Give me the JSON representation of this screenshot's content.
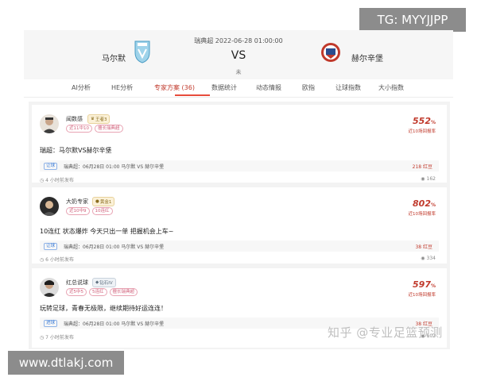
{
  "watermarks": {
    "top": "TG: MYYJJPP",
    "bottom": "www.dtlakj.com",
    "zhihu": "知乎 @专业足篮预测"
  },
  "match": {
    "meta": "瑞典超 2022-06-28 01:00:00",
    "home": "马尔默",
    "away": "赫尔辛堡",
    "vs": "VS",
    "state": "未"
  },
  "tabs": [
    {
      "label": "AI分析"
    },
    {
      "label": "HE分析"
    },
    {
      "label": "专家方案 (36)"
    },
    {
      "label": "数据统计"
    },
    {
      "label": "动态情报"
    },
    {
      "label": "欧指"
    },
    {
      "label": "让球指数"
    },
    {
      "label": "大小指数"
    }
  ],
  "cards": [
    {
      "name": "闻数感",
      "level": "王者3",
      "tags": [
        "近11中10",
        "擅长瑞典超"
      ],
      "rate": "552",
      "rate_unit": "%",
      "rate_label": "近10场回报率",
      "title": "瑞超：马尔默VS赫尔辛堡",
      "match_tag": "让球",
      "match_text": "瑞典超：06月28日 01:00    马尔默  VS  赫尔辛堡",
      "price": "218 红豆",
      "time": "4 小时前发布",
      "views": "162"
    },
    {
      "name": "大奶专家",
      "level": "黄金1",
      "tags": [
        "近10中9",
        "10连红"
      ],
      "rate": "802",
      "rate_unit": "%",
      "rate_label": "近10场回报率",
      "title": "10连红 状态爆炸 今天只出一单 把握机会上车~",
      "match_tag": "让球",
      "match_text": "瑞典超：06月28日 01:00    马尔默  VS  赫尔辛堡",
      "price": "38 红豆",
      "time": "6 小时前发布",
      "views": "334"
    },
    {
      "name": "红总说球",
      "level": "钻石IV",
      "tags": [
        "近5中5",
        "5连红",
        "擅长瑞典超"
      ],
      "rate": "597",
      "rate_unit": "%",
      "rate_label": "近10场回报率",
      "title": "玩转足球，青春无极限，继续期待好运连连！",
      "match_tag": "进球",
      "match_text": "瑞典超：06月28日 01:00    马尔默  VS  赫尔辛堡",
      "price": "38 红豆",
      "time": "7 小时前发布",
      "views": "502"
    }
  ]
}
